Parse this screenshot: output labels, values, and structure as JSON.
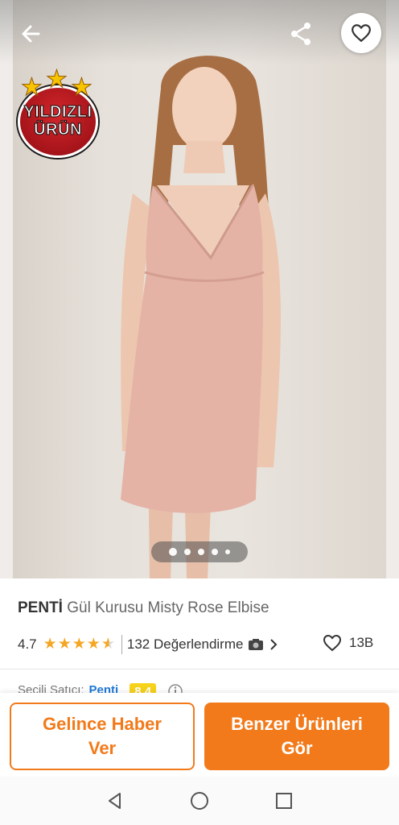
{
  "badge": {
    "line1": "YILDIZLI",
    "line2": "ÜRÜN"
  },
  "gallery": {
    "image_count": 5,
    "active_index": 0
  },
  "product": {
    "brand": "PENTİ",
    "name": "Gül Kurusu Misty Rose Elbise",
    "rating": "4.7",
    "stars": 4.5,
    "reviews_text": "132 Değerlendirme",
    "favorite_count": "13B"
  },
  "seller": {
    "label": "Seçili Satıcı:",
    "name": "Penti",
    "score": "8.4"
  },
  "actions": {
    "notify_label": "Gelince Haber Ver",
    "similar_label": "Benzer Ürünleri Gör"
  },
  "icons": {
    "back": "arrow-left-icon",
    "share": "share-icon",
    "favorite": "heart-outline-icon",
    "camera": "camera-icon",
    "chevron": "chevron-right-icon",
    "info": "info-icon",
    "nav_back": "triangle-back-icon",
    "nav_home": "circle-home-icon",
    "nav_recents": "square-recents-icon"
  },
  "colors": {
    "accent": "#f27a1a",
    "star": "#f5a623",
    "seller_link": "#1e78d8",
    "score_bg": "#f7d21a"
  }
}
